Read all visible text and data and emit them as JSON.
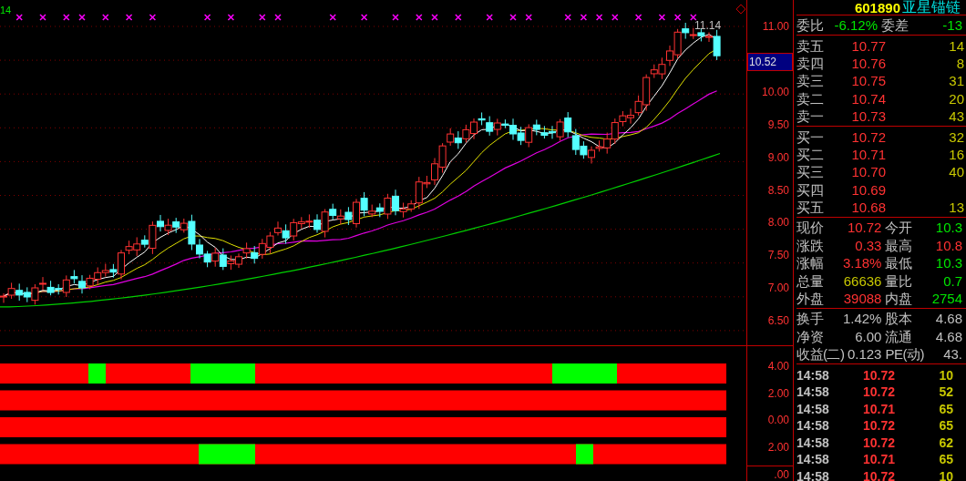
{
  "chart": {
    "corner_label": "14",
    "high_label": "11.14",
    "axis": [
      {
        "kind": "tick",
        "text": "11.00"
      },
      {
        "kind": "current",
        "text": "10.52"
      },
      {
        "kind": "tick",
        "text": "10.00"
      },
      {
        "kind": "tick",
        "text": "9.50"
      },
      {
        "kind": "tick",
        "text": "9.00"
      },
      {
        "kind": "tick",
        "text": "8.50"
      },
      {
        "kind": "tick",
        "text": "8.00"
      },
      {
        "kind": "tick",
        "text": "7.50"
      },
      {
        "kind": "tick",
        "text": "7.00"
      },
      {
        "kind": "tick",
        "text": "6.50"
      }
    ]
  },
  "indicator": {
    "axis": [
      "4.00",
      "2.00",
      "0.00",
      "2.00"
    ],
    "bottom_label": ".00"
  },
  "quote": {
    "code": "601890",
    "name": "亚星锚链",
    "ratio": [
      {
        "label": "委比",
        "value": "-6.12%",
        "color": "#00e600"
      },
      {
        "label": "委差",
        "value": "-13",
        "color": "#00e600"
      }
    ],
    "asks": [
      {
        "label": "卖五",
        "price": "10.77",
        "volume": "14"
      },
      {
        "label": "卖四",
        "price": "10.76",
        "volume": "8"
      },
      {
        "label": "卖三",
        "price": "10.75",
        "volume": "31"
      },
      {
        "label": "卖二",
        "price": "10.74",
        "volume": "20"
      },
      {
        "label": "卖一",
        "price": "10.73",
        "volume": "43"
      }
    ],
    "bids": [
      {
        "label": "买一",
        "price": "10.72",
        "volume": "32"
      },
      {
        "label": "买二",
        "price": "10.71",
        "volume": "16"
      },
      {
        "label": "买三",
        "price": "10.70",
        "volume": "40"
      },
      {
        "label": "买四",
        "price": "10.69"
      },
      {
        "label": "买五",
        "price": "10.68",
        "volume": "13"
      }
    ],
    "stats": [
      [
        {
          "label": "现价",
          "value": "10.72",
          "color": "#ff3232"
        },
        {
          "label": "今开",
          "value": "10.3",
          "color": "#00e600"
        }
      ],
      [
        {
          "label": "涨跌",
          "value": "0.33",
          "color": "#ff3232"
        },
        {
          "label": "最高",
          "value": "10.8",
          "color": "#ff3232"
        }
      ],
      [
        {
          "label": "涨幅",
          "value": "3.18%",
          "color": "#ff3232"
        },
        {
          "label": "最低",
          "value": "10.3",
          "color": "#00e600"
        }
      ],
      [
        {
          "label": "总量",
          "value": "66636",
          "color": "#c8c800"
        },
        {
          "label": "量比",
          "value": "0.7",
          "color": "#00e600"
        }
      ],
      [
        {
          "label": "外盘",
          "value": "39088",
          "color": "#ff3232"
        },
        {
          "label": "内盘",
          "value": "2754",
          "color": "#00e600"
        }
      ]
    ],
    "finance": [
      [
        {
          "label": "换手",
          "value": "1.42%",
          "color": "#c0c0c0"
        },
        {
          "label": "股本",
          "value": "4.68",
          "color": "#c0c0c0"
        }
      ],
      [
        {
          "label": "净资",
          "value": "6.00",
          "color": "#c0c0c0"
        },
        {
          "label": "流通",
          "value": "4.68",
          "color": "#c0c0c0"
        }
      ],
      [
        {
          "label": "收益(二)",
          "value": "0.123",
          "color": "#c0c0c0"
        },
        {
          "label": "PE(动)",
          "value": "43.",
          "color": "#c0c0c0"
        }
      ]
    ],
    "ticks": [
      {
        "time": "14:58",
        "price": "10.72",
        "volume": "10"
      },
      {
        "time": "14:58",
        "price": "10.72",
        "volume": "52"
      },
      {
        "time": "14:58",
        "price": "10.71",
        "volume": "65"
      },
      {
        "time": "14:58",
        "price": "10.72",
        "volume": "65"
      },
      {
        "time": "14:58",
        "price": "10.72",
        "volume": "62"
      },
      {
        "time": "14:58",
        "price": "10.71",
        "volume": "65"
      },
      {
        "time": "14:58",
        "price": "10.72",
        "volume": "10"
      }
    ]
  }
}
